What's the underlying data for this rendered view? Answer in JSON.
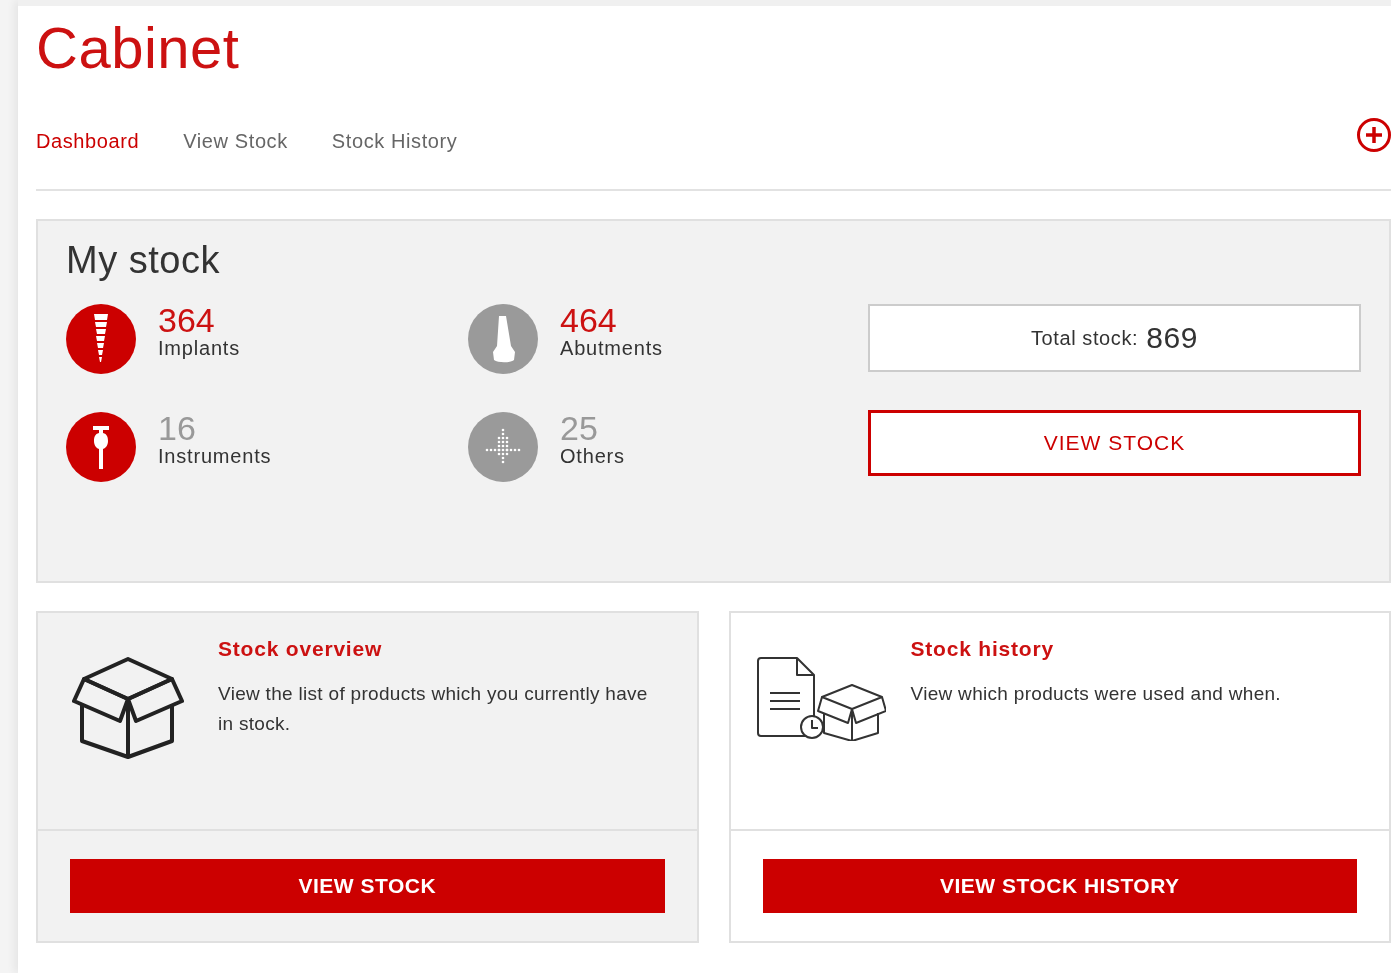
{
  "title": "Cabinet",
  "tabs": [
    {
      "label": "Dashboard",
      "selected": true
    },
    {
      "label": "View Stock",
      "selected": false
    },
    {
      "label": "Stock History",
      "selected": false
    }
  ],
  "my_stock": {
    "title": "My stock",
    "items": [
      {
        "kind": "implant",
        "count": "364",
        "label": "Implants",
        "color": "#cc0000",
        "highlighted": true
      },
      {
        "kind": "abutment",
        "count": "464",
        "label": "Abutments",
        "color": "#9a9a9a",
        "highlighted": true
      },
      {
        "kind": "instrument",
        "count": "16",
        "label": "Instruments",
        "color": "#cc0000",
        "highlighted": false
      },
      {
        "kind": "other",
        "count": "25",
        "label": "Others",
        "color": "#9a9a9a",
        "highlighted": false
      }
    ],
    "total_label": "Total stock:",
    "total_value": "869",
    "button": "VIEW STOCK"
  },
  "cards": [
    {
      "kind": "box",
      "shaded": true,
      "title": "Stock overview",
      "text": "View the list of products which you currently have in stock.",
      "button": "VIEW STOCK"
    },
    {
      "kind": "history",
      "shaded": false,
      "title": "Stock history",
      "text": "View which products were used and when.",
      "button": "VIEW STOCK HISTORY"
    }
  ]
}
